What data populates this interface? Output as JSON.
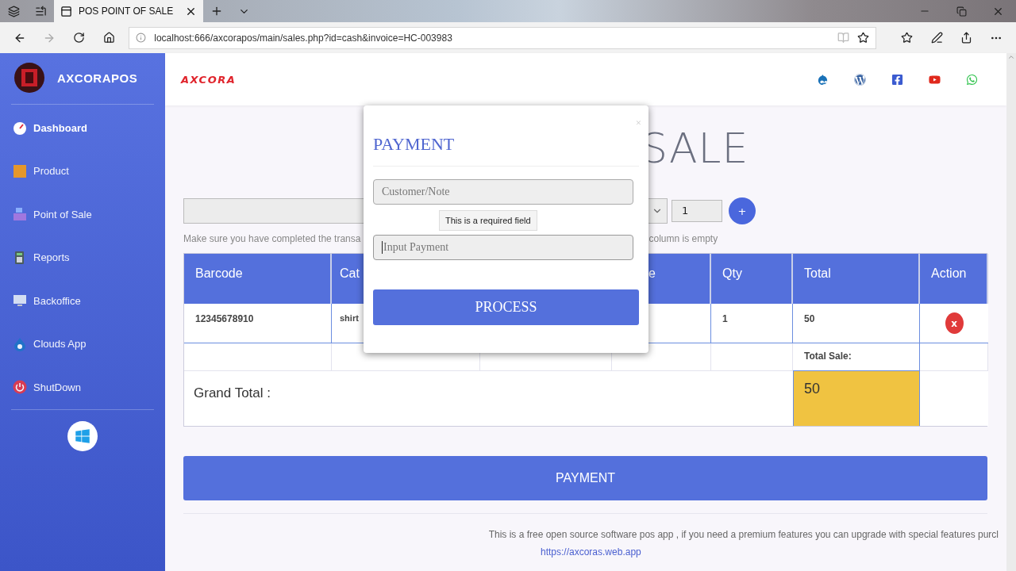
{
  "browser": {
    "tabs": [
      {
        "title": "POS POINT OF SALE",
        "selected": true
      }
    ],
    "url": "localhost:666/axcorapos/main/sales.php?id=cash&invoice=HC-003983"
  },
  "sidebar": {
    "brand": "AXCORAPOS",
    "items": [
      {
        "label": "Dashboard",
        "kind": "gauge",
        "selected": true
      },
      {
        "label": "Product",
        "kind": "box",
        "selected": false
      },
      {
        "label": "Point of Sale",
        "kind": "register",
        "selected": false
      },
      {
        "label": "Reports",
        "kind": "calculator",
        "selected": false
      },
      {
        "label": "Backoffice",
        "kind": "monitor",
        "selected": false
      },
      {
        "label": "Clouds App",
        "kind": "drop",
        "selected": false
      },
      {
        "label": "ShutDown",
        "kind": "power",
        "selected": false
      }
    ]
  },
  "header": {
    "logo": "AXCORA"
  },
  "page": {
    "heading": "SALE",
    "quantity": "1",
    "add_button": "+",
    "hint_left": "Make sure you have completed the transa",
    "hint_right": "column is empty"
  },
  "table": {
    "columns": [
      "Barcode",
      "Cat",
      null,
      "e",
      "Qty",
      "Total",
      "Action"
    ],
    "rows": [
      {
        "cells": [
          "12345678910",
          "shirt",
          null,
          null,
          "1",
          "50"
        ],
        "action": "x"
      }
    ],
    "total_label": "Total Sale:",
    "grand_total_label": "Grand Total :",
    "grand_total": "50"
  },
  "payment_button": "PAYMENT",
  "footer": {
    "text": "This is a free open source software pos app , if you need a premium features you can upgrade with special features purcl",
    "link": "https://axcoras.web.app"
  },
  "modal": {
    "title": "PAYMENT",
    "close": "×",
    "fields": [
      {
        "placeholder": "Customer/Note",
        "focused": false
      },
      {
        "placeholder": "Input Payment",
        "focused": true
      }
    ],
    "tooltip": "This is a required field",
    "button": "PROCESS"
  }
}
